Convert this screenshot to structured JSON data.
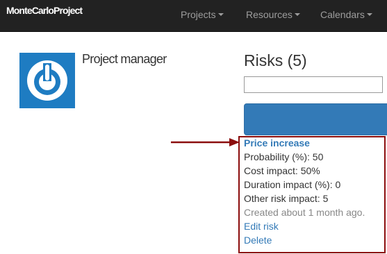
{
  "navbar": {
    "brand": "MonteCarloProject",
    "menus": [
      {
        "label": "Projects"
      },
      {
        "label": "Resources"
      },
      {
        "label": "Calendars"
      }
    ]
  },
  "profile": {
    "title": "Project manager",
    "avatar_icon": "power-icon",
    "avatar_color": "#1e7cc2"
  },
  "risks": {
    "heading": "Risks (5)",
    "search_value": "",
    "button_color": "#337ab7",
    "item": {
      "name": "Price increase",
      "probability": "Probability (%): 50",
      "cost_impact": "Cost impact: 50%",
      "duration_impact": "Duration impact (%): 0",
      "other_impact": "Other risk impact: 5",
      "created": "Created about 1 month ago.",
      "edit_label": "Edit risk",
      "delete_label": "Delete"
    }
  },
  "annotation": {
    "color": "#8b0d0d"
  }
}
